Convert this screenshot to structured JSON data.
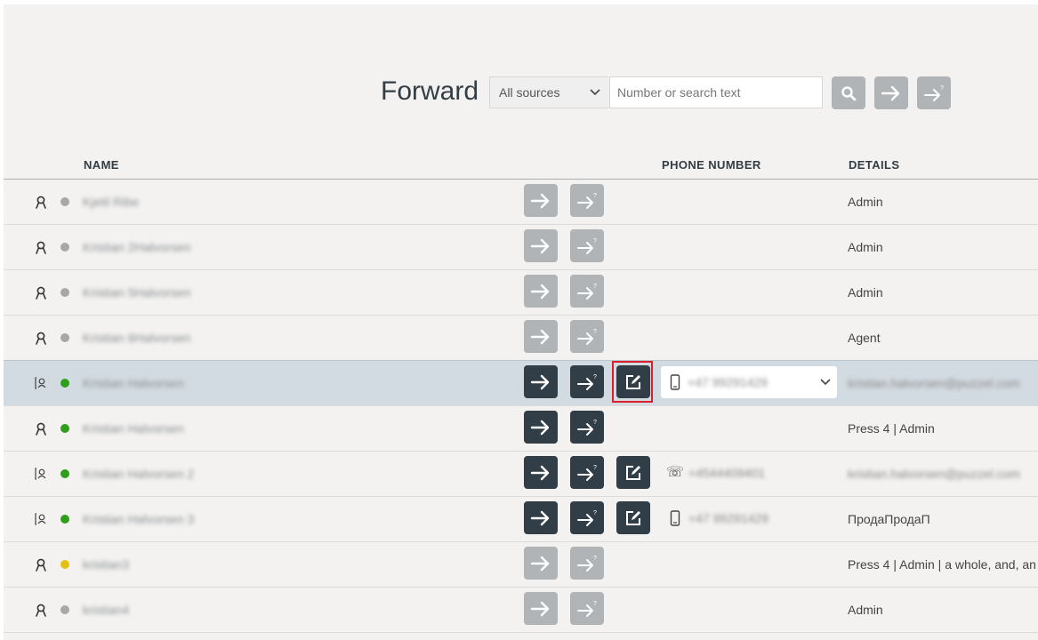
{
  "toolbar": {
    "title": "Forward",
    "source_select": "All sources",
    "search_placeholder": "Number or search text",
    "search_icon": "search-icon",
    "forward_icon": "arrow-right-icon",
    "consult_icon": "arrow-right-question-icon"
  },
  "columns": {
    "name": "NAME",
    "phone": "PHONE NUMBER",
    "details": "DETAILS"
  },
  "colors": {
    "status_gray": "#a7a7a7",
    "status_green": "#2f9e1a",
    "status_yellow": "#e2c112",
    "button_light": "#b0b4b7",
    "button_dark": "#313d47",
    "selected_row": "#d3dbe2",
    "highlight": "#d9202c"
  },
  "rows": [
    {
      "type": "user",
      "status": "gray",
      "name": "Kjetil Ribe",
      "enabled": false,
      "edit": false,
      "phone_icon": "",
      "phone": "",
      "details": "Admin",
      "details_blurred": false
    },
    {
      "type": "user",
      "status": "gray",
      "name": "Kristian 2Halvorsen",
      "enabled": false,
      "edit": false,
      "phone_icon": "",
      "phone": "",
      "details": "Admin",
      "details_blurred": false
    },
    {
      "type": "user",
      "status": "gray",
      "name": "Kristian 5Halvorsen",
      "enabled": false,
      "edit": false,
      "phone_icon": "",
      "phone": "",
      "details": "Admin",
      "details_blurred": false
    },
    {
      "type": "user",
      "status": "gray",
      "name": "Kristian 6Halvorsen",
      "enabled": false,
      "edit": false,
      "phone_icon": "",
      "phone": "",
      "details": "Agent",
      "details_blurred": false
    },
    {
      "type": "contact",
      "status": "green",
      "name": "Kristian Halvorsen",
      "enabled": true,
      "edit": true,
      "selected": true,
      "phone_icon": "mobile-phone-icon",
      "phone": "+47 99291429",
      "details": "kristian.halvorsen@puzzel.com",
      "details_blurred": true
    },
    {
      "type": "user",
      "status": "green",
      "name": "Kristian Halvorsen",
      "enabled": true,
      "edit": false,
      "phone_icon": "",
      "phone": "",
      "details": "Press 4 | Admin",
      "details_blurred": false
    },
    {
      "type": "contact",
      "status": "green",
      "name": "Kristian Halvorsen 2",
      "enabled": true,
      "edit": true,
      "phone_icon": "landline-phone-icon",
      "phone": "+4544409401",
      "details": "kristian.halvorsen@puzzel.com",
      "details_blurred": true
    },
    {
      "type": "contact",
      "status": "green",
      "name": "Kristian Halvorsen 3",
      "enabled": true,
      "edit": true,
      "phone_icon": "mobile-phone-icon",
      "phone": "+47 99291429",
      "details": "ПродаПродаП",
      "details_blurred": false
    },
    {
      "type": "user",
      "status": "yellow",
      "name": "kristian3",
      "enabled": false,
      "edit": false,
      "phone_icon": "",
      "phone": "",
      "details": "Press 4 | Admin | a whole, and, an",
      "details_blurred": false
    },
    {
      "type": "user",
      "status": "gray",
      "name": "kristian4",
      "enabled": false,
      "edit": false,
      "phone_icon": "",
      "phone": "",
      "details": "Admin",
      "details_blurred": false
    }
  ]
}
